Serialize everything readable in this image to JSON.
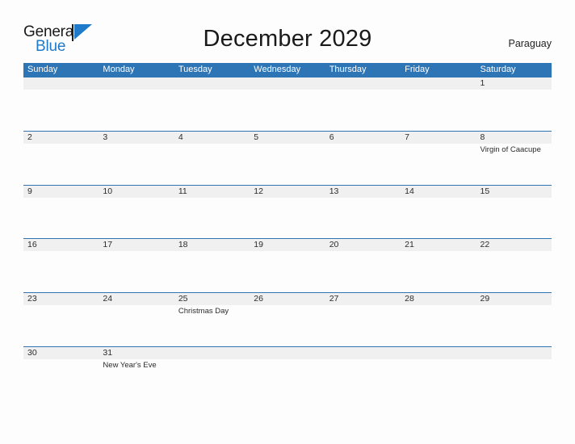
{
  "brand": {
    "name_part1": "General",
    "name_part2": "Blue",
    "flag_icon": "flag-icon"
  },
  "header": {
    "title": "December 2029",
    "region": "Paraguay"
  },
  "colors": {
    "header_blue": "#2e75b6",
    "row_divider_blue": "#2e75b6",
    "band_gray": "#f0f0f0",
    "logo_blue": "#1f7ac9",
    "page_background": "#fdfdfd",
    "text": "#2b2b2b"
  },
  "calendar": {
    "weekdays": [
      "Sunday",
      "Monday",
      "Tuesday",
      "Wednesday",
      "Thursday",
      "Friday",
      "Saturday"
    ],
    "weeks": [
      [
        {
          "day": "",
          "event": ""
        },
        {
          "day": "",
          "event": ""
        },
        {
          "day": "",
          "event": ""
        },
        {
          "day": "",
          "event": ""
        },
        {
          "day": "",
          "event": ""
        },
        {
          "day": "",
          "event": ""
        },
        {
          "day": "1",
          "event": ""
        }
      ],
      [
        {
          "day": "2",
          "event": ""
        },
        {
          "day": "3",
          "event": ""
        },
        {
          "day": "4",
          "event": ""
        },
        {
          "day": "5",
          "event": ""
        },
        {
          "day": "6",
          "event": ""
        },
        {
          "day": "7",
          "event": ""
        },
        {
          "day": "8",
          "event": "Virgin of Caacupe"
        }
      ],
      [
        {
          "day": "9",
          "event": ""
        },
        {
          "day": "10",
          "event": ""
        },
        {
          "day": "11",
          "event": ""
        },
        {
          "day": "12",
          "event": ""
        },
        {
          "day": "13",
          "event": ""
        },
        {
          "day": "14",
          "event": ""
        },
        {
          "day": "15",
          "event": ""
        }
      ],
      [
        {
          "day": "16",
          "event": ""
        },
        {
          "day": "17",
          "event": ""
        },
        {
          "day": "18",
          "event": ""
        },
        {
          "day": "19",
          "event": ""
        },
        {
          "day": "20",
          "event": ""
        },
        {
          "day": "21",
          "event": ""
        },
        {
          "day": "22",
          "event": ""
        }
      ],
      [
        {
          "day": "23",
          "event": ""
        },
        {
          "day": "24",
          "event": ""
        },
        {
          "day": "25",
          "event": "Christmas Day"
        },
        {
          "day": "26",
          "event": ""
        },
        {
          "day": "27",
          "event": ""
        },
        {
          "day": "28",
          "event": ""
        },
        {
          "day": "29",
          "event": ""
        }
      ],
      [
        {
          "day": "30",
          "event": ""
        },
        {
          "day": "31",
          "event": "New Year's Eve"
        },
        {
          "day": "",
          "event": ""
        },
        {
          "day": "",
          "event": ""
        },
        {
          "day": "",
          "event": ""
        },
        {
          "day": "",
          "event": ""
        },
        {
          "day": "",
          "event": ""
        }
      ]
    ]
  }
}
